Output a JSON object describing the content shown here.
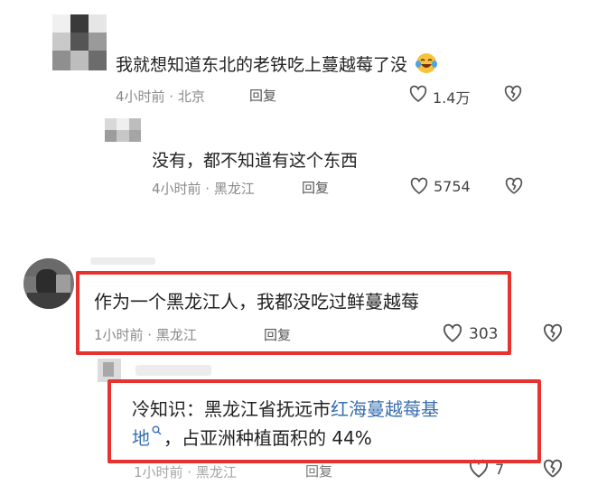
{
  "comments": [
    {
      "text": "我就想知道东北的老铁吃上蔓越莓了没",
      "time_location": "4小时前 · 北京",
      "reply_label": "回复",
      "likes": "1.4万"
    },
    {
      "text": "没有，都不知道有这个东西",
      "time_location": "4小时前 · 黑龙江",
      "reply_label": "回复",
      "likes": "5754"
    },
    {
      "text": "作为一个黑龙江人，我都没吃过鲜蔓越莓",
      "time_location": "1小时前 · 黑龙江",
      "reply_label": "回复",
      "likes": "303"
    },
    {
      "text_prefix": "冷知识：黑龙江省抚远市",
      "link_part1": "红海蔓越莓基",
      "link_part2": "地",
      "text_suffix": "，占亚洲种植面积的 44%",
      "time_location": "1小时前 · 黑龙江",
      "reply_label": "回复",
      "likes": "7"
    }
  ],
  "colors": {
    "highlight": "#e8322d",
    "link": "#3a6fb0"
  },
  "icons": [
    "heart-icon",
    "broken-heart-icon",
    "laughing-emoji-icon",
    "search-icon"
  ]
}
